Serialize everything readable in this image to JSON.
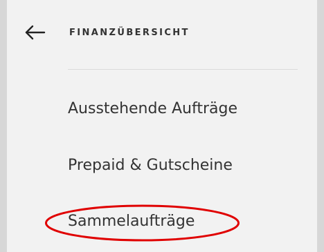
{
  "header": {
    "back_icon": "arrow-left-icon",
    "title": "FINANZÜBERSICHT"
  },
  "menu": {
    "items": [
      {
        "label": "Ausstehende Aufträge"
      },
      {
        "label": "Prepaid & Gutscheine"
      },
      {
        "label": "Sammelaufträge"
      }
    ]
  },
  "annotation": {
    "highlight_target": "Sammelaufträge",
    "highlight_color": "#e00000"
  },
  "colors": {
    "background": "#d7d7d7",
    "panel": "#f2f2f2",
    "text": "#333333",
    "divider": "#dadada"
  }
}
